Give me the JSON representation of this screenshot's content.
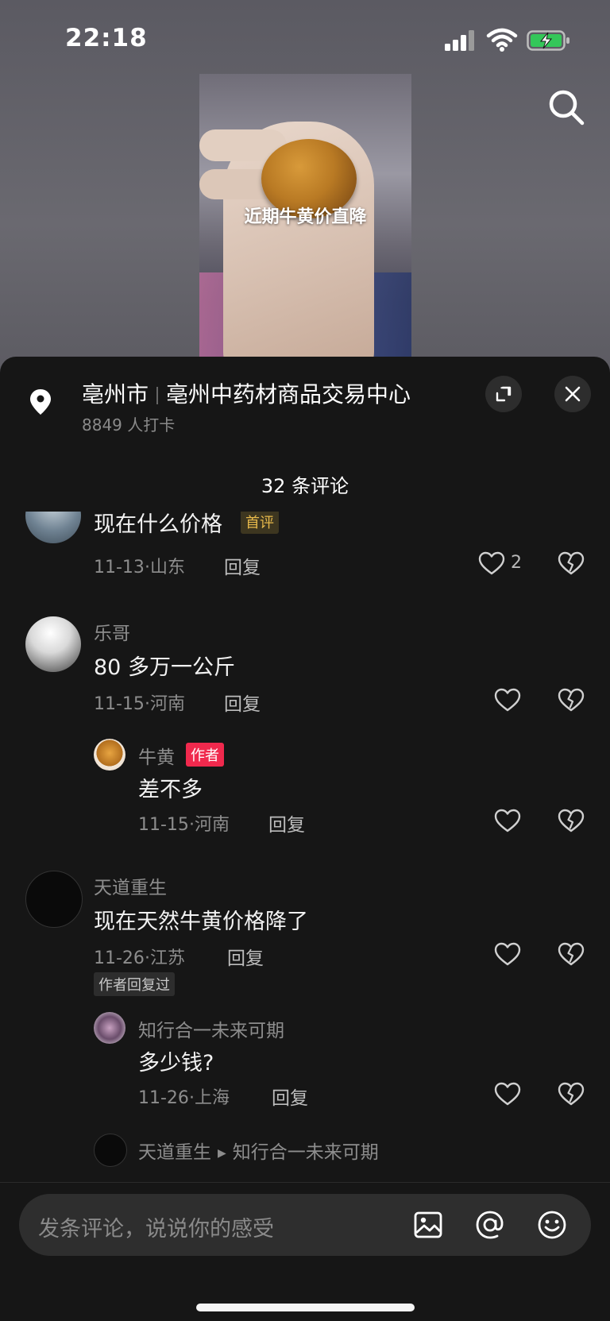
{
  "status": {
    "time": "22:18"
  },
  "video": {
    "caption": "近期牛黄价直降"
  },
  "location": {
    "city": "亳州市",
    "place": "亳州中药材商品交易中心",
    "checkins": "8849 人打卡"
  },
  "comment_count": "32 条评论",
  "comments": [
    {
      "text": "现在什么价格",
      "tag": "首评",
      "date": "11-13",
      "region": "山东",
      "reply_label": "回复",
      "likes": "2"
    },
    {
      "name": "乐哥",
      "text": "80 多万一公斤",
      "date": "11-15",
      "region": "河南",
      "reply_label": "回复",
      "replies": [
        {
          "name": "牛黄",
          "tag": "作者",
          "text": "差不多",
          "date": "11-15",
          "region": "河南",
          "reply_label": "回复"
        }
      ]
    },
    {
      "name": "天道重生",
      "text": "现在天然牛黄价格降了",
      "date": "11-26",
      "region": "江苏",
      "reply_label": "回复",
      "badge": "作者回复过",
      "replies": [
        {
          "name": "知行合一未来可期",
          "text": "多少钱?",
          "date": "11-26",
          "region": "上海",
          "reply_label": "回复"
        },
        {
          "name": "天道重生",
          "reply_to": "知行合一未来可期"
        }
      ]
    }
  ],
  "input": {
    "placeholder": "发条评论，说说你的感受"
  },
  "colors": {
    "sheet_bg": "#161616",
    "author_tag": "#f0294d",
    "first_tag_text": "#e7b94b"
  }
}
